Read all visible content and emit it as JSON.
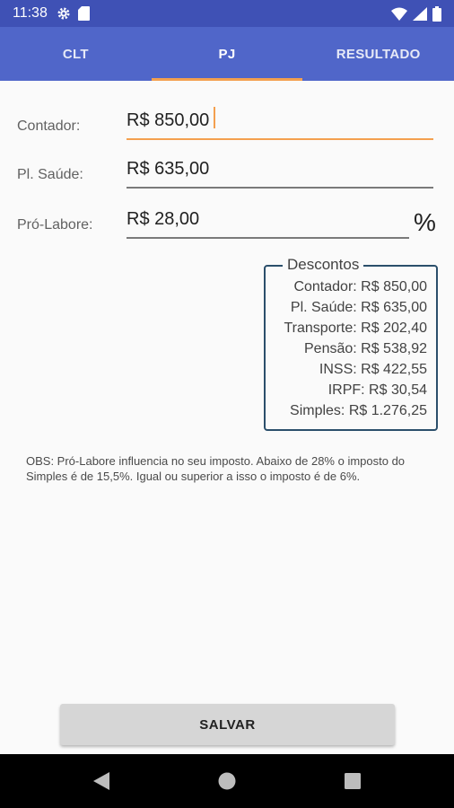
{
  "status_bar": {
    "time": "11:38",
    "left_icons": [
      "settings-gear-icon",
      "sd-card-icon"
    ],
    "right_icons": [
      "wifi-icon",
      "signal-icon",
      "battery-icon"
    ]
  },
  "tabs": [
    {
      "label": "CLT",
      "active": false
    },
    {
      "label": "PJ",
      "active": true
    },
    {
      "label": "RESULTADO",
      "active": false
    }
  ],
  "form": {
    "contador": {
      "label": "Contador:",
      "value": "R$ 850,00"
    },
    "plano_saude": {
      "label": "Pl. Saúde:",
      "value": "R$ 635,00"
    },
    "pro_labore": {
      "label": "Pró-Labore:",
      "value": "R$ 28,00",
      "suffix": "%"
    }
  },
  "descontos": {
    "title": "Descontos",
    "items": [
      "Contador: R$ 850,00",
      "Pl. Saúde: R$ 635,00",
      "Transporte: R$ 202,40",
      "Pensão: R$ 538,92",
      "INSS: R$ 422,55",
      "IRPF: R$ 30,54",
      "Simples: R$ 1.276,25"
    ]
  },
  "obs": "OBS: Pró-Labore influencia no seu imposto. Abaixo de 28% o imposto do Simples é de 15,5%. Igual ou superior a isso o imposto é de 6%.",
  "save_button": {
    "label": "SALVAR"
  },
  "colors": {
    "status_bar": "#3f51b5",
    "tab_bar": "#5066c9",
    "accent": "#f4a04f",
    "box_border": "#2b4f6b",
    "background": "#fafafa"
  }
}
